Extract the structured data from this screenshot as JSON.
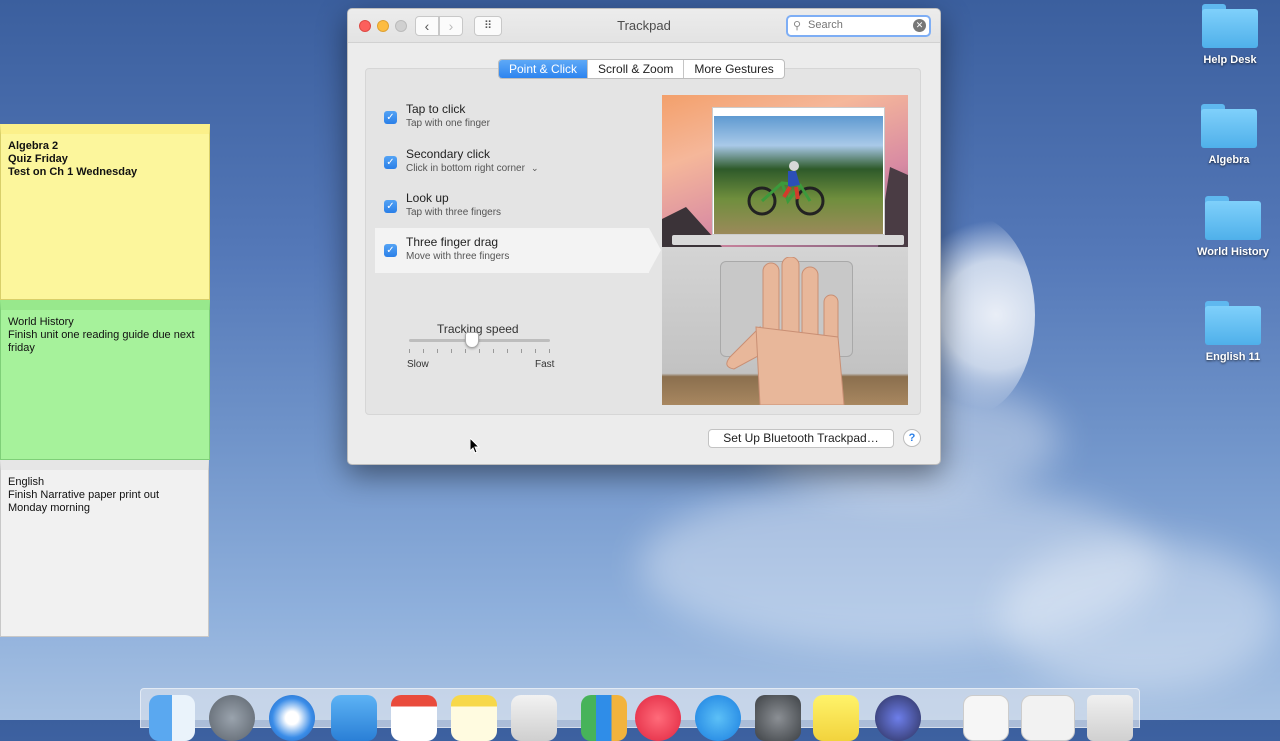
{
  "window": {
    "title": "Trackpad",
    "search_placeholder": "Search",
    "tabs": [
      {
        "label": "Point & Click",
        "active": true
      },
      {
        "label": "Scroll & Zoom",
        "active": false
      },
      {
        "label": "More Gestures",
        "active": false
      }
    ],
    "options": [
      {
        "label": "Tap to click",
        "sub": "Tap with one finger",
        "checked": true
      },
      {
        "label": "Secondary click",
        "sub": "Click in bottom right corner",
        "checked": true
      },
      {
        "label": "Look up",
        "sub": "Tap with three fingers",
        "checked": true
      },
      {
        "label": "Three finger drag",
        "sub": "Move with three fingers",
        "checked": true
      }
    ],
    "tracking": {
      "label": "Tracking speed",
      "min_label": "Slow",
      "max_label": "Fast",
      "value_fraction": 0.45
    },
    "bluetooth_button": "Set Up Bluetooth Trackpad…",
    "help_label": "?"
  },
  "notes": [
    {
      "color": "yellow",
      "lines": "Algebra 2\nQuiz Friday\nTest on Ch 1 Wednesday"
    },
    {
      "color": "green",
      "lines": "World History\nFinish unit one reading guide due next\nfriday"
    },
    {
      "color": "white",
      "lines": "English\nFinish Narrative paper print out\nMonday morning"
    }
  ],
  "desktop_folders": [
    {
      "label": "Help Desk"
    },
    {
      "label": "Algebra"
    },
    {
      "label": "World History"
    },
    {
      "label": "English 11"
    }
  ],
  "colors": {
    "accent": "#2d84ef",
    "note_yellow": "#fcf69c",
    "note_green": "#a6f29b",
    "folder": "#5fb8ef"
  }
}
